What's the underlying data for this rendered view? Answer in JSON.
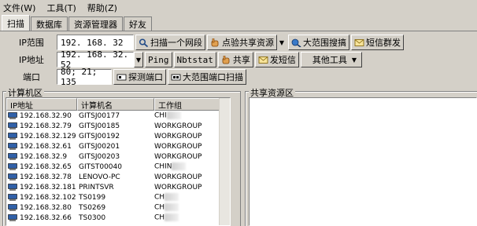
{
  "menu": [
    {
      "label": "文件(W)"
    },
    {
      "label": "工具(T)"
    },
    {
      "label": "帮助(Z)"
    }
  ],
  "tabs": [
    {
      "label": "扫描"
    },
    {
      "label": "数据库"
    },
    {
      "label": "资源管理器"
    },
    {
      "label": "好友"
    }
  ],
  "scan": {
    "ip_range_label": "IP范围",
    "ip_range_value": "192. 168. 32",
    "scan_segment": "扫描一个网段",
    "verify_share": "点验共享资源",
    "big_search": "大范围搜搞",
    "sms": "短信群发",
    "ip_addr_label": "IP地址",
    "ip_addr_value": "192. 168. 32. 52",
    "ping": "Ping",
    "nbtstat": "Nbtstat",
    "share": "共享",
    "send_sms": "发短信",
    "other_tools": "其他工具",
    "port_label": "端口",
    "port_value": "80; 21; 135",
    "detect_port": "探测端口",
    "big_port_scan": "大范围端口扫描"
  },
  "computer_area": {
    "title": "计算机区",
    "columns": [
      "IP地址",
      "计算机名",
      "工作组"
    ],
    "rows": [
      {
        "ip": "192.168.32.90",
        "name": "GITSJ00177",
        "group": "CHI"
      },
      {
        "ip": "192.168.32.79",
        "name": "GITSJ00185",
        "group": "WORKGROUP"
      },
      {
        "ip": "192.168.32.129",
        "name": "GITSJ00192",
        "group": "WORKGROUP"
      },
      {
        "ip": "192.168.32.61",
        "name": "GITSJ00201",
        "group": "WORKGROUP"
      },
      {
        "ip": "192.168.32.9",
        "name": "GITSJ00203",
        "group": "WORKGROUP"
      },
      {
        "ip": "192.168.32.65",
        "name": "GITST00040",
        "group": "CHIN"
      },
      {
        "ip": "192.168.32.78",
        "name": "LENOVO-PC",
        "group": "WORKGROUP"
      },
      {
        "ip": "192.168.32.181",
        "name": "PRINTSVR",
        "group": "WORKGROUP"
      },
      {
        "ip": "192.168.32.102",
        "name": "TS0199",
        "group": "CH"
      },
      {
        "ip": "192.168.32.80",
        "name": "TS0269",
        "group": "CH"
      },
      {
        "ip": "192.168.32.66",
        "name": "TS0300",
        "group": "CH"
      }
    ]
  },
  "share_area": {
    "title": "共享资源区"
  }
}
